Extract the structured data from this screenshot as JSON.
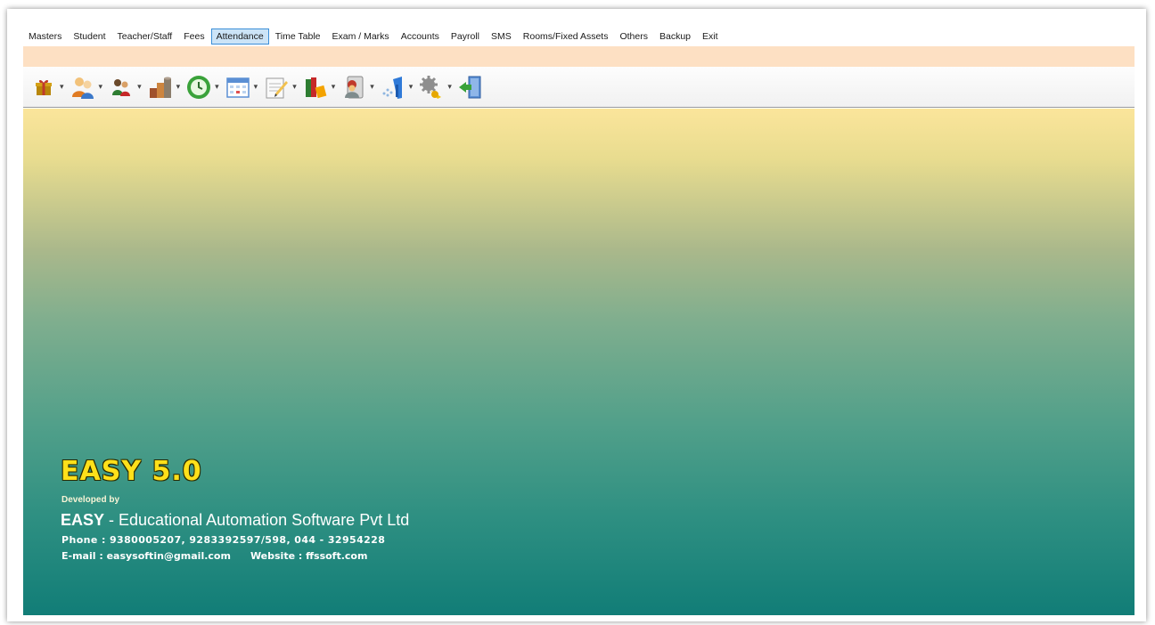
{
  "menu": {
    "items": [
      "Masters",
      "Student",
      "Teacher/Staff",
      "Fees",
      "Attendance",
      "Time Table",
      "Exam / Marks",
      "Accounts",
      "Payroll",
      "SMS",
      "Rooms/Fixed Assets",
      "Others",
      "Backup",
      "Exit"
    ],
    "active": "Attendance"
  },
  "toolbar": {
    "buttons": [
      "gift-icon",
      "users-icon",
      "people-icon",
      "coins-icon",
      "clock-icon",
      "calendar-icon",
      "notepad-icon",
      "books-icon",
      "contacts-icon",
      "chart-icon",
      "settings-icon",
      "exit-door-icon"
    ]
  },
  "brand": {
    "title": "EASY 5.0",
    "developed_by": "Developed by",
    "company_short": "EASY",
    "company_rest": " - Educational Automation Software Pvt Ltd",
    "phone": "Phone : 9380005207, 9283392597/598,  044 - 32954228",
    "email": "E-mail : easysoftin@gmail.com",
    "website": "Website : ffssoft.com"
  },
  "colors": {
    "menu_active_bg": "#cce4f7",
    "strip": "#fde0c3",
    "title": "#ffe01a",
    "gradient_top": "#fbe59b",
    "gradient_bottom": "#117d77"
  }
}
